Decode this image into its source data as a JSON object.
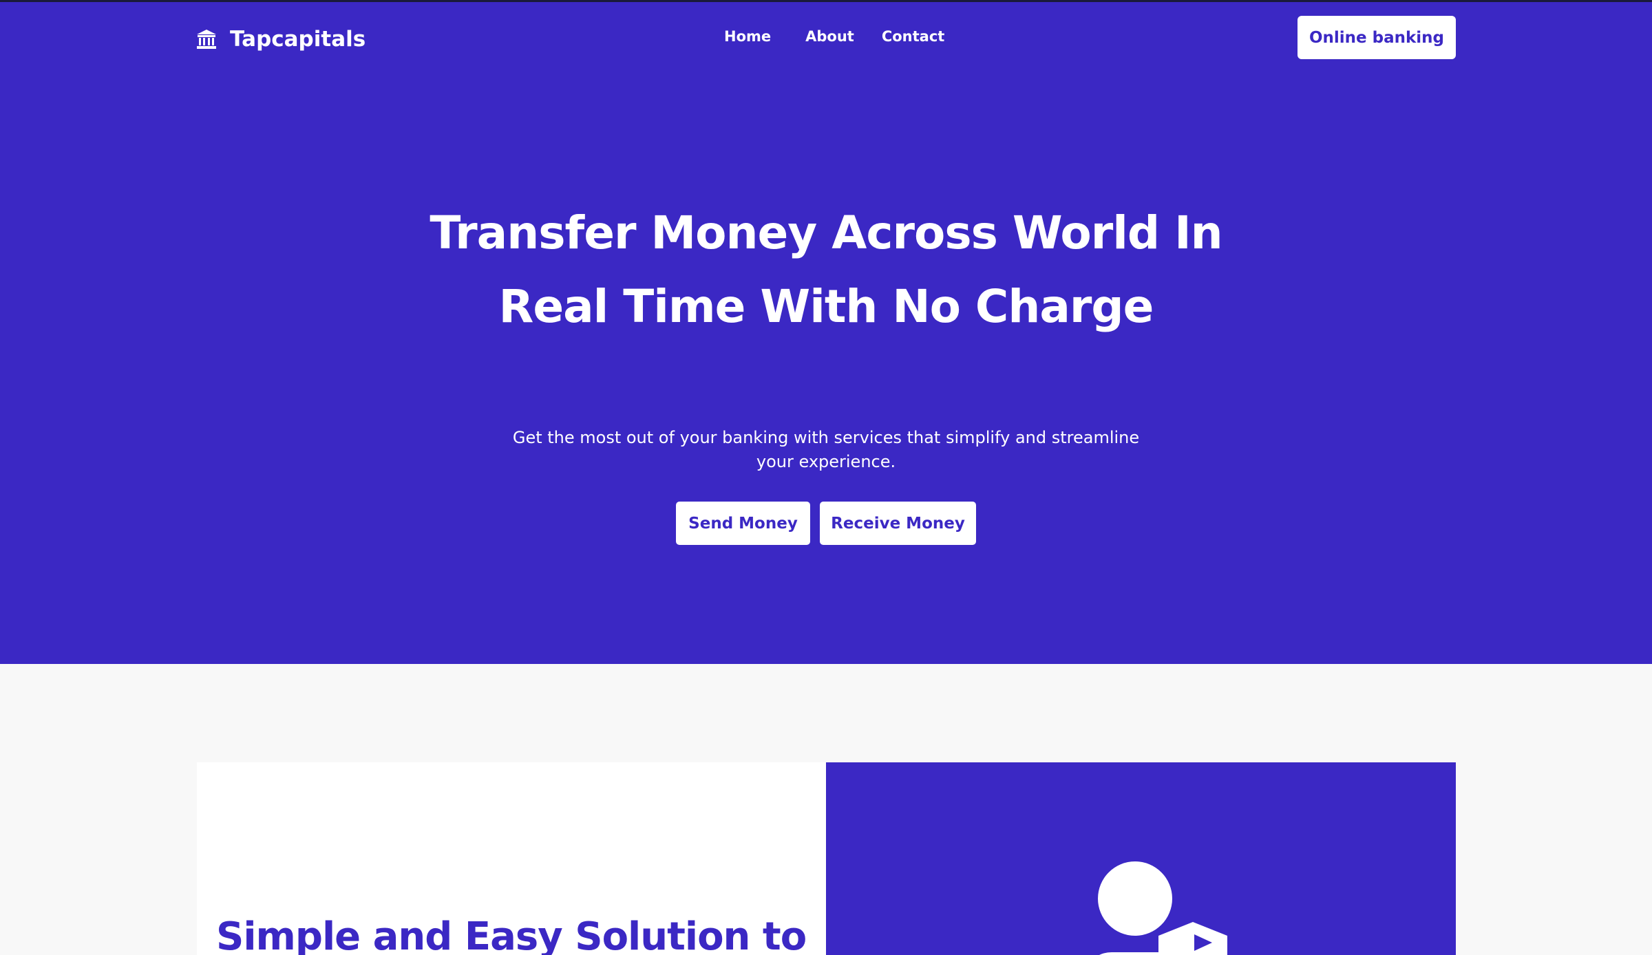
{
  "colors": {
    "primary": "#3b28c4",
    "white": "#ffffff",
    "background": "#f8f8f8"
  },
  "header": {
    "brand_icon": "bank-icon",
    "brand_name": "Tapcapitals",
    "nav": {
      "home": "Home",
      "about": "About",
      "contact": "Contact"
    },
    "cta_label": "Online banking"
  },
  "hero": {
    "title": "Transfer Money Across World In Real Time With No Charge",
    "subtitle": "Get the most out of your banking with services that simplify and streamline your experience.",
    "send_label": "Send Money",
    "receive_label": "Receive Money"
  },
  "section": {
    "title": "Simple and Easy Solution to",
    "illustration_icon": "person-shield-icon"
  }
}
